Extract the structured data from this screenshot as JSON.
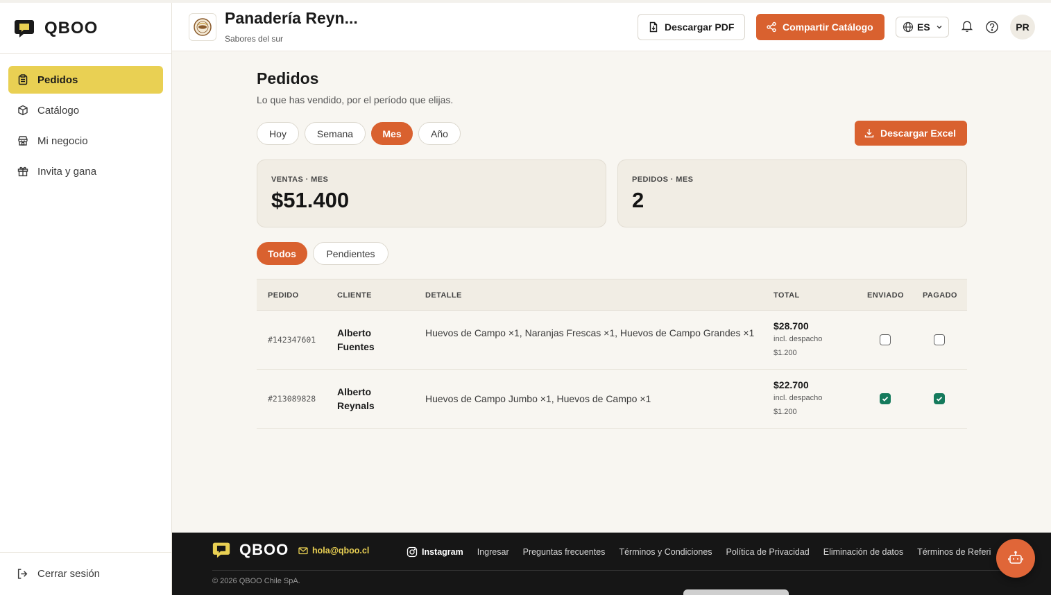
{
  "brand": {
    "name": "QBOO"
  },
  "sidebar": {
    "items": [
      {
        "label": "Pedidos",
        "icon": "clipboard-icon",
        "active": true
      },
      {
        "label": "Catálogo",
        "icon": "box-icon",
        "active": false
      },
      {
        "label": "Mi negocio",
        "icon": "store-icon",
        "active": false
      },
      {
        "label": "Invita y gana",
        "icon": "gift-icon",
        "active": false
      }
    ],
    "logout_label": "Cerrar sesión"
  },
  "header": {
    "store_name": "Panadería Reyn...",
    "store_subtitle": "Sabores del sur",
    "download_pdf_label": "Descargar PDF",
    "share_catalog_label": "Compartir Catálogo",
    "language": "ES",
    "avatar_initials": "PR"
  },
  "main": {
    "title": "Pedidos",
    "subtitle": "Lo que has vendido, por el período que elijas.",
    "periods": [
      "Hoy",
      "Semana",
      "Mes",
      "Año"
    ],
    "active_period": "Mes",
    "download_excel_label": "Descargar Excel",
    "stats": [
      {
        "label": "VENTAS · MES",
        "value": "$51.400"
      },
      {
        "label": "PEDIDOS · MES",
        "value": "2"
      }
    ],
    "filters": [
      "Todos",
      "Pendientes"
    ],
    "active_filter": "Todos",
    "table": {
      "headers": [
        "PEDIDO",
        "CLIENTE",
        "DETALLE",
        "TOTAL",
        "ENVIADO",
        "PAGADO"
      ],
      "rows": [
        {
          "id": "#142347601",
          "client": "Alberto Fuentes",
          "detail": "Huevos de Campo ×1, Naranjas Frescas ×1, Huevos de Campo Grandes ×1",
          "total": "$28.700",
          "shipping_note": "incl. despacho $1.200",
          "sent": false,
          "paid": false
        },
        {
          "id": "#213089828",
          "client": "Alberto Reynals",
          "detail": "Huevos de Campo Jumbo ×1, Huevos de Campo ×1",
          "total": "$22.700",
          "shipping_note": "incl. despacho $1.200",
          "sent": true,
          "paid": true
        }
      ]
    }
  },
  "footer": {
    "brand": "QBOO",
    "email": "hola@qboo.cl",
    "links": [
      "Instagram",
      "Ingresar",
      "Preguntas frecuentes",
      "Términos y Condiciones",
      "Política de Privacidad",
      "Eliminación de datos",
      "Términos de Referi"
    ],
    "copyright": "© 2026 QBOO Chile SpA."
  },
  "colors": {
    "accent": "#d9612f",
    "highlight": "#e9d053",
    "check": "#157a5c",
    "footer_bg": "#161616",
    "main_bg": "#f8f6f1"
  }
}
